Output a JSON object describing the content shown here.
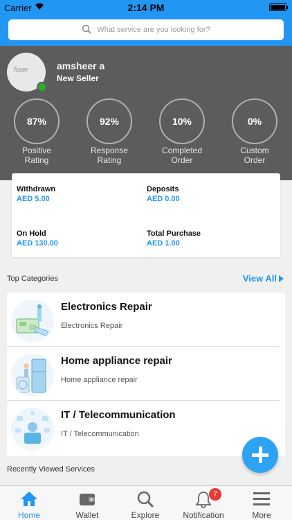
{
  "status_bar": {
    "carrier": "Carrier",
    "time": "2:14 PM"
  },
  "search": {
    "placeholder": "What service are you looking for?"
  },
  "profile": {
    "name": "amsheer a",
    "role": "New Seller",
    "avatar_logo_text": "fixer"
  },
  "stats": [
    {
      "value": "87%",
      "label": "Positive\nRating"
    },
    {
      "value": "92%",
      "label": "Response\nRating"
    },
    {
      "value": "10%",
      "label": "Completed\nOrder"
    },
    {
      "value": "0%",
      "label": "Custom\nOrder"
    }
  ],
  "wallet": {
    "withdrawn_label": "Withdrawn",
    "withdrawn_value": "AED 5.00",
    "deposits_label": "Deposits",
    "deposits_value": "AED 0.00",
    "onhold_label": "On Hold",
    "onhold_value": "AED 130.00",
    "purchase_label": "Total Purchase",
    "purchase_value": "AED 1.00"
  },
  "categories": {
    "title": "Top Categories",
    "view_all": "View All",
    "items": [
      {
        "title": "Electronics Repair",
        "subtitle": "Electronics Repair"
      },
      {
        "title": "Home appliance repair",
        "subtitle": "Home appliance repair"
      },
      {
        "title": "IT / Telecommunication",
        "subtitle": "IT / Telecommunication"
      }
    ]
  },
  "recent": {
    "title": "Recently Viewed Services"
  },
  "tabs": [
    {
      "label": "Home",
      "icon": "home-icon"
    },
    {
      "label": "Wallet",
      "icon": "wallet-icon"
    },
    {
      "label": "Explore",
      "icon": "search-icon"
    },
    {
      "label": "Notification",
      "icon": "bell-icon",
      "badge": "7"
    },
    {
      "label": "More",
      "icon": "menu-icon"
    }
  ],
  "colors": {
    "accent": "#2196f3",
    "profile_bg": "#5c5c5c",
    "badge": "#e53935",
    "online": "#2eaa2e"
  }
}
